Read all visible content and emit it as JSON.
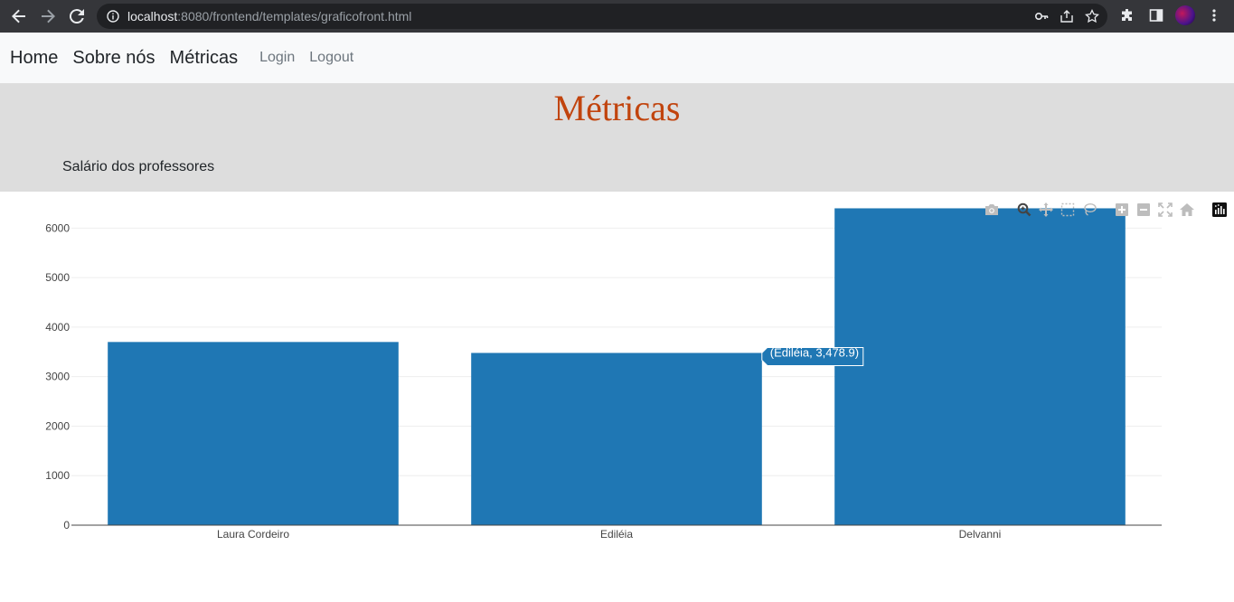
{
  "browser": {
    "url_host": "localhost",
    "url_rest": ":8080/frontend/templates/graficofront.html"
  },
  "navbar": {
    "home": "Home",
    "about": "Sobre nós",
    "metrics": "Métricas",
    "login": "Login",
    "logout": "Logout"
  },
  "header": {
    "title": "Métricas",
    "subtitle": "Salário dos professores"
  },
  "colors": {
    "bar": "#1f77b4",
    "title": "#c1440e"
  },
  "modebar_icons": [
    "camera-icon",
    "zoom-icon",
    "pan-icon",
    "box-select-icon",
    "lasso-select-icon",
    "zoom-in-icon",
    "zoom-out-icon",
    "autoscale-icon",
    "reset-axes-icon",
    "plotly-logo-icon"
  ],
  "hover": {
    "text": "(Ediléia, 3,478.9)"
  },
  "chart_data": {
    "type": "bar",
    "categories": [
      "Laura Cordeiro",
      "Ediléia",
      "Delvanni"
    ],
    "values": [
      3700,
      3478.9,
      6400
    ],
    "yticks": [
      0,
      1000,
      2000,
      3000,
      4000,
      5000,
      6000
    ],
    "ylim": [
      0,
      6737
    ],
    "grid": true,
    "title": "",
    "xlabel": "",
    "ylabel": ""
  }
}
